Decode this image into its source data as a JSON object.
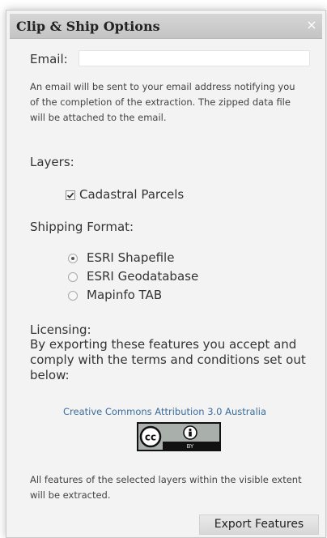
{
  "dialog": {
    "title": "Clip & Ship Options",
    "close_symbol": "×"
  },
  "email": {
    "label": "Email:",
    "value": "",
    "placeholder": "",
    "note": "An email will be sent to your email address notifying you of the completion of the extraction. The zipped data file will be attached to the email."
  },
  "layers": {
    "label": "Layers:",
    "items": [
      {
        "label": "Cadastral Parcels",
        "checked": true
      }
    ]
  },
  "shipping": {
    "label": "Shipping Format:",
    "options": [
      {
        "label": "ESRI Shapefile",
        "selected": true
      },
      {
        "label": "ESRI Geodatabase",
        "selected": false
      },
      {
        "label": "Mapinfo TAB",
        "selected": false
      }
    ]
  },
  "licensing": {
    "label": "Licensing:",
    "text": "By exporting these features you accept and comply with the terms and conditions set out below:",
    "link_label": "Creative Commons Attribution 3.0 Australia",
    "badge_icon": "cc-by-icon"
  },
  "footer": {
    "note": "All features of the selected layers within the visible extent will be extracted.",
    "export_label": "Export Features"
  },
  "colors": {
    "link": "#3a6d9c",
    "panel_bg": "#f3f3f3",
    "titlebar_bg": "#cdcdcd"
  }
}
